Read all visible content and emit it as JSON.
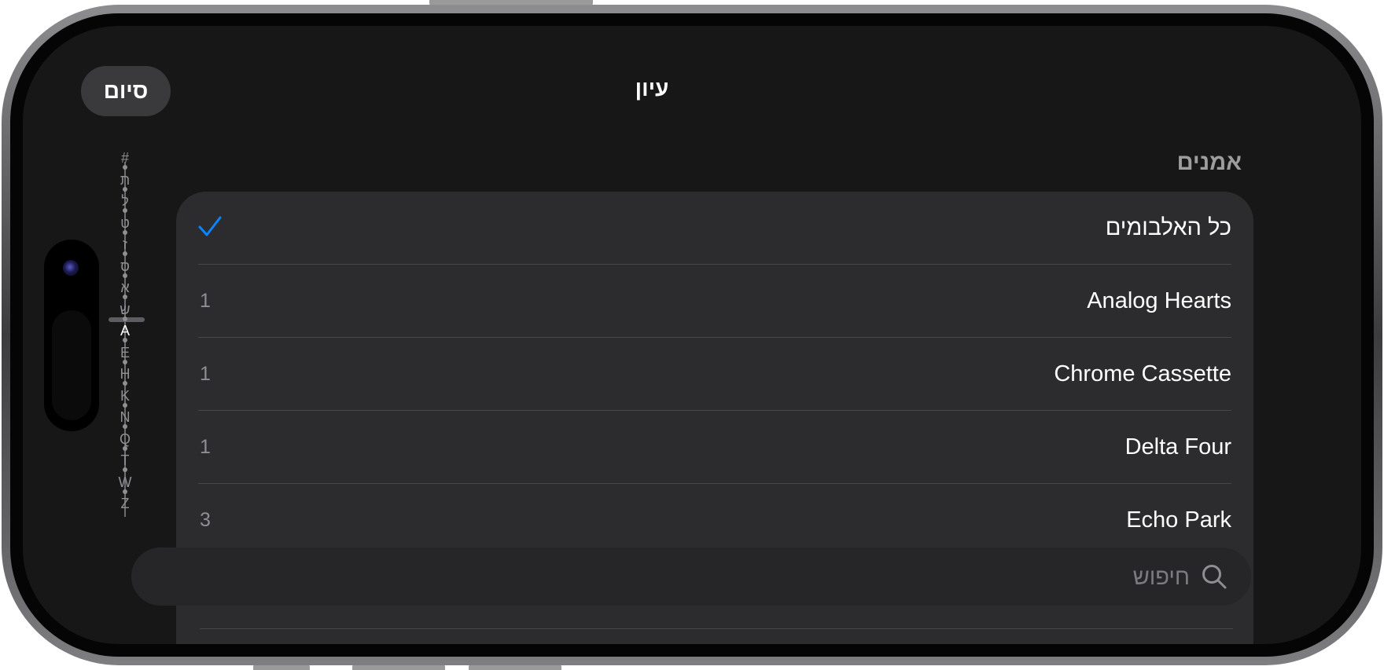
{
  "nav": {
    "done_label": "סיום",
    "title": "עיון"
  },
  "section": {
    "header": "אמנים"
  },
  "rows": [
    {
      "label": "כל האלבומים",
      "count": "",
      "selected": true
    },
    {
      "label": "Analog Hearts",
      "count": "1",
      "selected": false
    },
    {
      "label": "Chrome Cassette",
      "count": "1",
      "selected": false
    },
    {
      "label": "Delta Four",
      "count": "1",
      "selected": false
    },
    {
      "label": "Echo Park",
      "count": "3",
      "selected": false
    }
  ],
  "search": {
    "placeholder": "חיפוש",
    "value": ""
  },
  "index_bar": {
    "letters": [
      "#",
      "ת",
      "ל",
      "ט",
      "ז",
      "ס",
      "א",
      "ש",
      "A",
      "E",
      "H",
      "K",
      "N",
      "Q",
      "T",
      "W",
      "Z"
    ],
    "active": "A"
  },
  "colors": {
    "accent": "#0a84ff",
    "background": "#171717",
    "card": "#2c2c2e"
  },
  "icons": {
    "checkmark": "checkmark-icon",
    "search": "magnifying-glass-icon"
  }
}
